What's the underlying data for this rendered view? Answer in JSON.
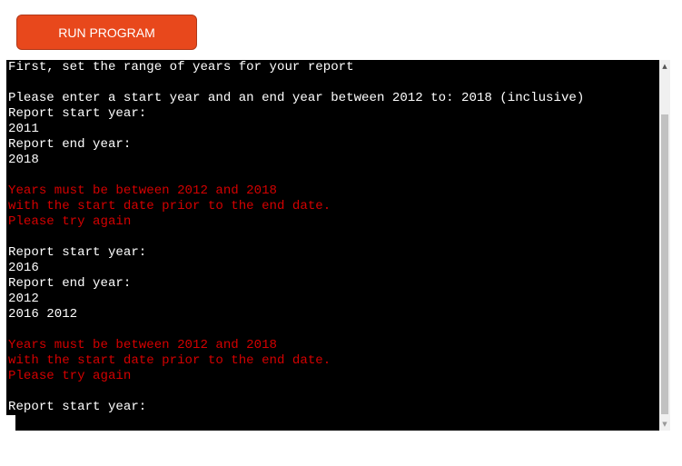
{
  "toolbar": {
    "run_label": "RUN PROGRAM"
  },
  "terminal": {
    "lines": [
      {
        "text": "First, set the range of years for your report",
        "color": "white"
      },
      {
        "text": "",
        "color": "white"
      },
      {
        "text": "Please enter a start year and an end year between 2012 to: 2018 (inclusive)",
        "color": "white"
      },
      {
        "text": "Report start year:",
        "color": "white"
      },
      {
        "text": "2011",
        "color": "white"
      },
      {
        "text": "Report end year:",
        "color": "white"
      },
      {
        "text": "2018",
        "color": "white"
      },
      {
        "text": "",
        "color": "white"
      },
      {
        "text": "Years must be between 2012 and 2018",
        "color": "red"
      },
      {
        "text": "with the start date prior to the end date.",
        "color": "red"
      },
      {
        "text": "Please try again",
        "color": "red"
      },
      {
        "text": "",
        "color": "white"
      },
      {
        "text": "Report start year:",
        "color": "white"
      },
      {
        "text": "2016",
        "color": "white"
      },
      {
        "text": "Report end year:",
        "color": "white"
      },
      {
        "text": "2012",
        "color": "white"
      },
      {
        "text": "2016 2012",
        "color": "white"
      },
      {
        "text": "",
        "color": "white"
      },
      {
        "text": "Years must be between 2012 and 2018",
        "color": "red"
      },
      {
        "text": "with the start date prior to the end date.",
        "color": "red"
      },
      {
        "text": "Please try again",
        "color": "red"
      },
      {
        "text": "",
        "color": "white"
      },
      {
        "text": "Report start year:",
        "color": "white"
      }
    ]
  },
  "scrollbar": {
    "up_icon": "scroll-up-arrow-icon",
    "down_icon": "scroll-down-arrow-icon"
  },
  "colors": {
    "button": "#e8481c",
    "terminal_bg": "#000000",
    "terminal_text": "#ffffff",
    "error_text": "#d40000"
  }
}
